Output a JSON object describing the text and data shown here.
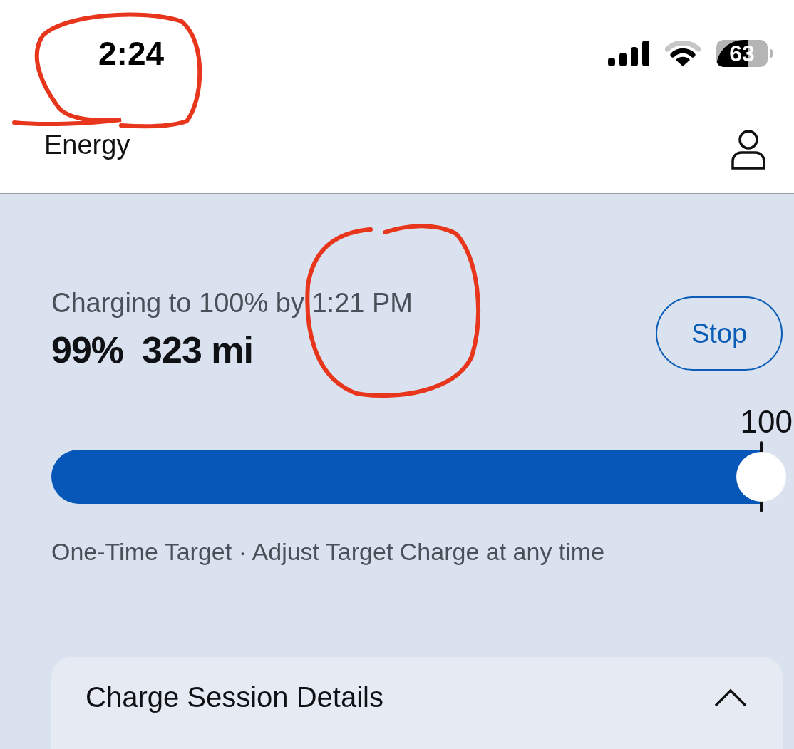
{
  "status_bar": {
    "time": "2:24",
    "battery": "63"
  },
  "header": {
    "title": "Energy"
  },
  "charge": {
    "status": "Charging to 100% by 1:21 PM",
    "percent": "99%",
    "range": "323 mi",
    "stop_button": "Stop"
  },
  "target_slider": {
    "label": "100",
    "level": 1.0
  },
  "caption": "One-Time Target · Adjust Target Charge at any time",
  "details_card": {
    "title": "Charge Session Details",
    "expanded": true
  }
}
